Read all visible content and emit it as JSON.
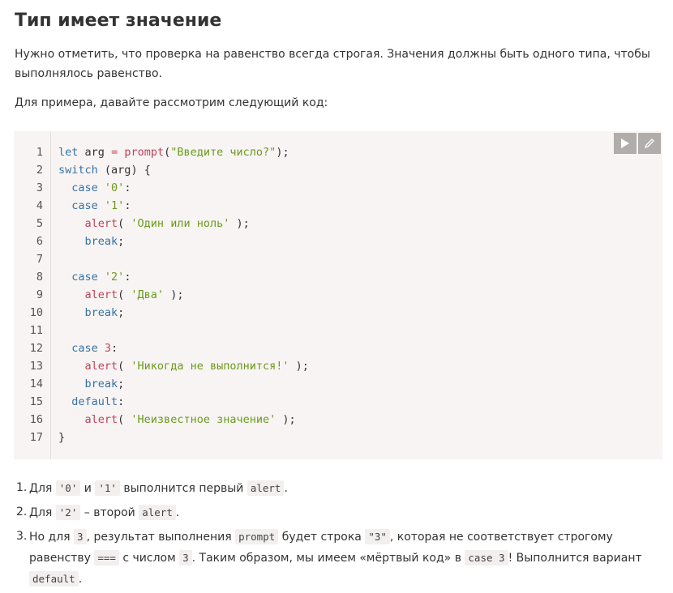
{
  "heading": "Тип имеет значение",
  "paragraph1": "Нужно отметить, что проверка на равенство всегда строгая. Значения должны быть одного типа, чтобы выполнялось равенство.",
  "paragraph2": "Для примера, давайте рассмотрим следующий код:",
  "toolbar": {
    "run_icon": "play-icon",
    "edit_icon": "pencil-icon"
  },
  "code_lines": [
    "let arg = prompt(\"Введите число?\");",
    "switch (arg) {",
    "  case '0':",
    "  case '1':",
    "    alert( 'Один или ноль' );",
    "    break;",
    "",
    "  case '2':",
    "    alert( 'Два' );",
    "    break;",
    "",
    "  case 3:",
    "    alert( 'Никогда не выполнится!' );",
    "    break;",
    "  default:",
    "    alert( 'Неизвестное значение' );",
    "}"
  ],
  "list": {
    "item1": {
      "n": "1.",
      "a": "Для ",
      "c1": "'0'",
      "b": " и ",
      "c2": "'1'",
      "d": " выполнится первый ",
      "c3": "alert",
      "e": "."
    },
    "item2": {
      "n": "2.",
      "a": "Для ",
      "c1": "'2'",
      "b": " – второй ",
      "c2": "alert",
      "e": "."
    },
    "item3": {
      "n": "3.",
      "a": "Но для ",
      "c1": "3",
      "b": ", результат выполнения ",
      "c2": "prompt",
      "c": " будет строка ",
      "c3": "\"3\"",
      "d": ", которая не соответствует строгому равенству ",
      "c4": "===",
      "e": " с числом ",
      "c5": "3",
      "f": ". Таким образом, мы имеем «мёртвый код» в ",
      "c6": "case 3",
      "g": "! Выполнится вариант ",
      "c7": "default",
      "h": "."
    }
  }
}
